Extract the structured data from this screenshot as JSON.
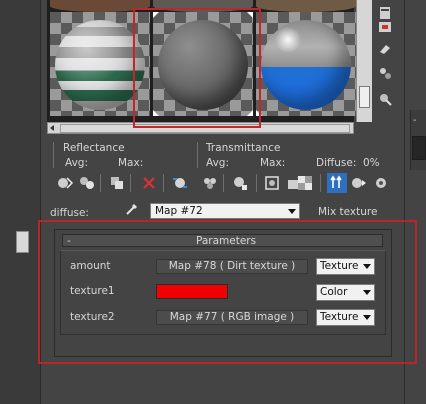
{
  "info": {
    "reflectance_title": "Reflectance",
    "transmittance_title": "Transmittance",
    "avg_label": "Avg:",
    "max_label": "Max:",
    "avg2_label": "Avg:",
    "max2_label": "Max:",
    "diffuse_label": "Diffuse:",
    "diffuse_value": "0%"
  },
  "map_slot": {
    "label": "diffuse:",
    "selected_map": "Map #72",
    "map_type": "Mix texture"
  },
  "parameters": {
    "toggle": "-",
    "title": "Parameters",
    "rows": [
      {
        "label": "amount",
        "map": "Map #78  ( Dirt texture )",
        "type": "Texture"
      },
      {
        "label": "texture1",
        "color": "#ff0000",
        "type": "Color"
      },
      {
        "label": "texture2",
        "map": "Map #77  ( RGB image )",
        "type": "Texture"
      }
    ]
  },
  "right_panel": {
    "toggle": "-"
  },
  "colors": {
    "accent_red": "#c0262b",
    "swatch_red": "#f00000",
    "panel_bg": "#444444"
  },
  "samples": [
    {
      "name": "striped-sphere"
    },
    {
      "name": "grey-noise-sphere"
    },
    {
      "name": "blue-glossy-sphere"
    }
  ],
  "toolbar_icons": [
    "get-material-icon",
    "put-material-icon",
    "assign-material-icon",
    "reset-icon",
    "copy-material-icon",
    "make-unique-icon",
    "material-effects-channel-icon",
    "show-map-icon",
    "show-end-result-icon",
    "go-to-parent-icon",
    "go-forward-sibling-icon",
    "background-icon"
  ]
}
